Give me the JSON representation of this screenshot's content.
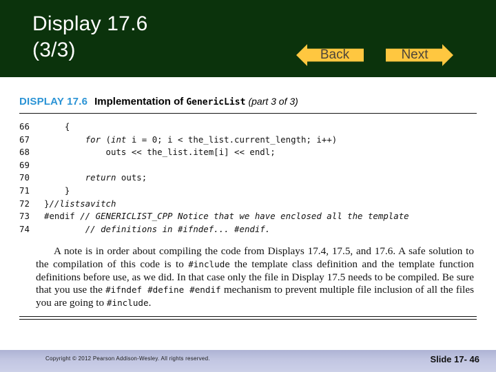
{
  "theme": {
    "header_bg": "#0b330c",
    "title_color": "#ffffff",
    "button_fill": "#ffc740",
    "button_text": "#4c4439",
    "display_label_color": "#2a93d5",
    "footer_gradient_top": "#aeb3d4",
    "footer_gradient_bottom": "#ccd0e8"
  },
  "header": {
    "title_line1": "Display 17.6",
    "title_line2": "(3/3)",
    "back_label": "Back",
    "next_label": "Next"
  },
  "figure": {
    "display_label": "DISPLAY 17.6",
    "display_title": "Implementation of",
    "display_mono": "GenericList",
    "display_part": "(part 3 of 3)",
    "code": [
      {
        "line": "66",
        "segments": [
          {
            "text": "    {",
            "style": "plain"
          }
        ]
      },
      {
        "line": "67",
        "segments": [
          {
            "text": "        ",
            "style": "plain"
          },
          {
            "text": "for",
            "style": "kw"
          },
          {
            "text": " (",
            "style": "plain"
          },
          {
            "text": "int",
            "style": "kw"
          },
          {
            "text": " i = 0; i < the_list.current_length; i++)",
            "style": "plain"
          }
        ]
      },
      {
        "line": "68",
        "segments": [
          {
            "text": "            outs << the_list.item[i] << endl;",
            "style": "plain"
          }
        ]
      },
      {
        "line": "69",
        "segments": [
          {
            "text": "",
            "style": "plain"
          }
        ]
      },
      {
        "line": "70",
        "segments": [
          {
            "text": "        ",
            "style": "plain"
          },
          {
            "text": "return",
            "style": "kw"
          },
          {
            "text": " outs;",
            "style": "plain"
          }
        ]
      },
      {
        "line": "71",
        "segments": [
          {
            "text": "    }",
            "style": "plain"
          }
        ]
      },
      {
        "line": "72",
        "segments": [
          {
            "text": "}",
            "style": "plain"
          },
          {
            "text": "//listsavitch",
            "style": "cmt"
          }
        ]
      },
      {
        "line": "73",
        "segments": [
          {
            "text": "#endif ",
            "style": "plain"
          },
          {
            "text": "// GENERICLIST_CPP Notice that we have enclosed all the template",
            "style": "cmt"
          }
        ]
      },
      {
        "line": "74",
        "segments": [
          {
            "text": "        ",
            "style": "plain"
          },
          {
            "text": "// definitions in #ifndef... #endif.",
            "style": "cmt"
          }
        ]
      }
    ],
    "note": [
      {
        "text": "A note is in order about compiling the code from Displays 17.4, 17.5, and 17.6. A safe solution to the compilation of this code is to ",
        "style": "plain"
      },
      {
        "text": "#include",
        "style": "code"
      },
      {
        "text": " the template class definition and the template function definitions before use, as we did. In that case only the file in Display 17.5 needs to be compiled. Be sure that you use the ",
        "style": "plain"
      },
      {
        "text": "#ifndef #define #endif",
        "style": "code"
      },
      {
        "text": " mechanism to prevent multiple file inclusion of all the files you are going to ",
        "style": "plain"
      },
      {
        "text": "#include",
        "style": "code"
      },
      {
        "text": ".",
        "style": "plain"
      }
    ]
  },
  "footer": {
    "copyright": "Copyright © 2012 Pearson Addison-Wesley.  All rights reserved.",
    "slide_number": "Slide 17- 46"
  }
}
